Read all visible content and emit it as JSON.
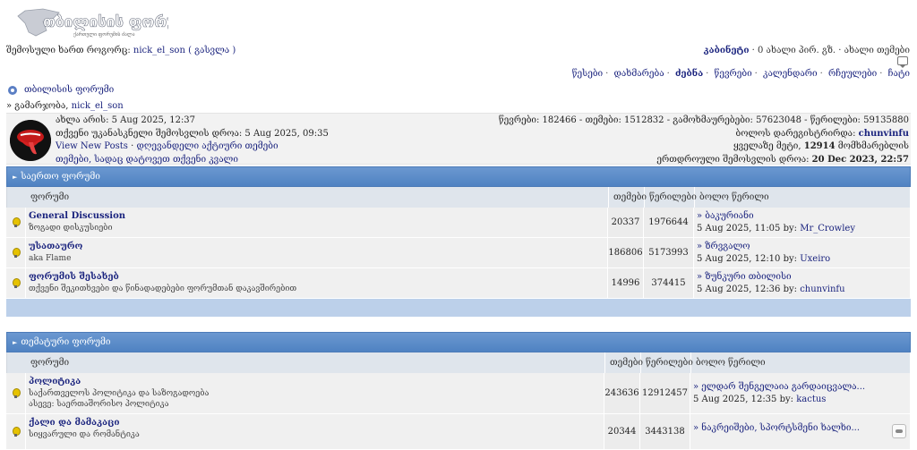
{
  "header": {
    "logo_icon": "tbilisi-forum-logo",
    "logo_text": "თბილისის ფორუმი",
    "logo_sub": "ქართული ფორუმის ძალა",
    "login_prefix": "შემოსული ხართ როგორც:",
    "username": "nick_el_son",
    "logout": "( გასვლა )",
    "cabinet": "კაბინეტი",
    "new_pm": "0 ახალი პირ. გზ.",
    "new_topics": "ახალი თემები"
  },
  "nav": {
    "items": [
      "წესები",
      "დახმარება",
      "ძებნა",
      "წევრები",
      "კალენდარი",
      "რჩეულები",
      "ჩატი"
    ]
  },
  "forum_title": "თბილისის ფორუმი",
  "breadcrumb": {
    "prefix": "» გამარჯობა,",
    "user": "nick_el_son"
  },
  "info": {
    "now": "ახლა არის: 5 Aug 2025, 12:37",
    "last_visit": "თქვენი უკანასკნელი შემოსვლის დროა: 5 Aug 2025, 09:35",
    "view_new": "View New Posts",
    "active_topics": "დღევანდელი აქტიური თემები",
    "your_topics": "თემები, სადაც დატოვეთ თქვენი კვალი",
    "stats": "წევრები: 182466 - თემები: 1512832 - გამოხმაურებები: 57623048 - წერილები: 59135880",
    "last_member_label": "ბოლოს დარეგისტრირდა:",
    "last_member": "chunvinfu",
    "max_online_label": "ყველაზე მეტი,",
    "max_online": "12914",
    "max_online_suffix": "მომხმარებლის",
    "max_time_label": "ერთდროული შემოსვლის დროა:",
    "max_time": "20 Dec 2023, 22:57"
  },
  "columns": {
    "forum": "ფორუმი",
    "topics": "თემები",
    "posts": "წერილები",
    "last": "ბოლო წერილი"
  },
  "categories": [
    {
      "title": "საერთო ფორუმი",
      "forums": [
        {
          "name": "General Discussion",
          "desc": "ზოგადი დისკუსიები",
          "topics": "20337",
          "posts": "1976644",
          "last_title": "» ბაკურიანი",
          "last_date": "5 Aug 2025, 11:05 by:",
          "last_user": "Mr_Crowley"
        },
        {
          "name": "უსათაურო",
          "desc": "aka Flame",
          "topics": "186806",
          "posts": "5173993",
          "last_title": "» ზრვგალო",
          "last_date": "5 Aug 2025, 12:10 by:",
          "last_user": "Uxeiro"
        },
        {
          "name": "ფორუმის შესახებ",
          "desc": "თქვენი შეკითხვები და წინადადებები ფორუმთან დაკავშირებით",
          "topics": "14996",
          "posts": "374415",
          "last_title": "» ზუნკური თბილისი",
          "last_date": "5 Aug 2025, 12:36 by:",
          "last_user": "chunvinfu"
        }
      ]
    },
    {
      "title": "თემატური ფორუმი",
      "forums": [
        {
          "name": "პოლიტიკა",
          "desc": "საქართველოს პოლიტიკა და საზოგადოება",
          "desc2": "ასევე: საერთაშორისო პოლიტიკა",
          "topics": "243636",
          "posts": "12912457",
          "last_title": "» ელდარ შენგელაია გარდაიცვალა...",
          "last_date": "5 Aug 2025, 12:35 by:",
          "last_user": "kactus"
        },
        {
          "name": "ქალი და მამაკაცი",
          "desc": "სიყვარული და რომანტიკა",
          "topics": "20344",
          "posts": "3443138",
          "last_title": "» ნაკრეიშები, სპორტსმენი ხალხი...",
          "last_date": "",
          "last_user": ""
        }
      ]
    }
  ]
}
